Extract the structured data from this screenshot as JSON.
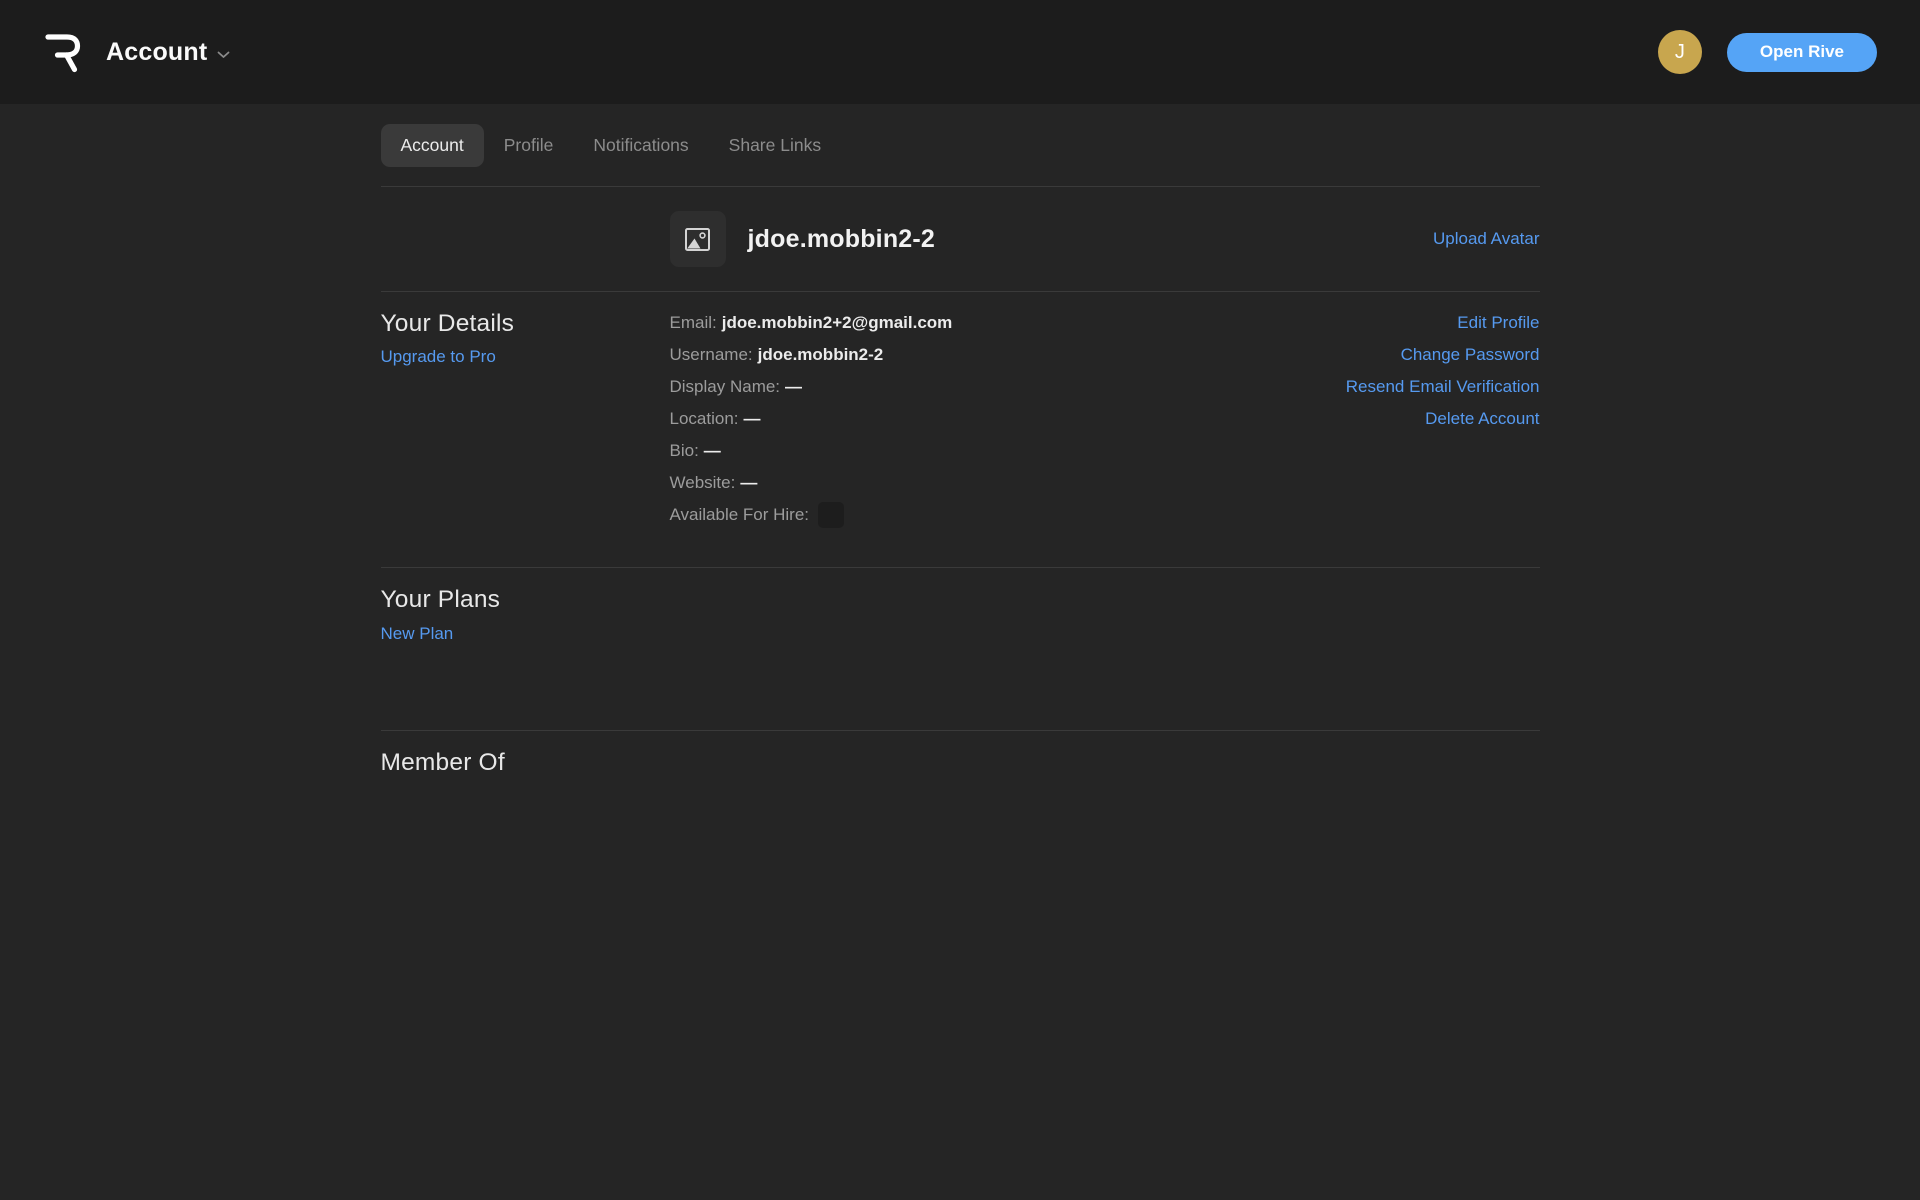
{
  "header": {
    "title": "Account",
    "avatar_initial": "J",
    "open_rive_label": "Open Rive"
  },
  "tabs": [
    {
      "label": "Account",
      "active": true
    },
    {
      "label": "Profile",
      "active": false
    },
    {
      "label": "Notifications",
      "active": false
    },
    {
      "label": "Share Links",
      "active": false
    }
  ],
  "profile": {
    "username_display": "jdoe.mobbin2-2",
    "upload_avatar_label": "Upload Avatar"
  },
  "details": {
    "heading": "Your Details",
    "upgrade_label": "Upgrade to Pro",
    "rows": [
      {
        "label": "Email:",
        "value": "jdoe.mobbin2+2@gmail.com"
      },
      {
        "label": "Username:",
        "value": "jdoe.mobbin2-2"
      },
      {
        "label": "Display Name:",
        "value": "—"
      },
      {
        "label": "Location:",
        "value": "—"
      },
      {
        "label": "Bio:",
        "value": "—"
      },
      {
        "label": "Website:",
        "value": "—"
      },
      {
        "label": "Available For Hire:",
        "value": "",
        "checkbox_checked": false
      }
    ],
    "actions": {
      "edit_profile": "Edit Profile",
      "change_password": "Change Password",
      "resend_email_verification": "Resend Email Verification",
      "delete_account": "Delete Account"
    }
  },
  "plans": {
    "heading": "Your Plans",
    "new_plan_label": "New Plan"
  },
  "member_of": {
    "heading": "Member Of"
  },
  "colors": {
    "header_bg": "#1c1c1c",
    "body_bg": "#252525",
    "accent_link_blue": "#569af0",
    "button_blue": "#55a4f6",
    "avatar_gold": "#c8a64e",
    "active_tab_bg": "#3a3a3a"
  }
}
